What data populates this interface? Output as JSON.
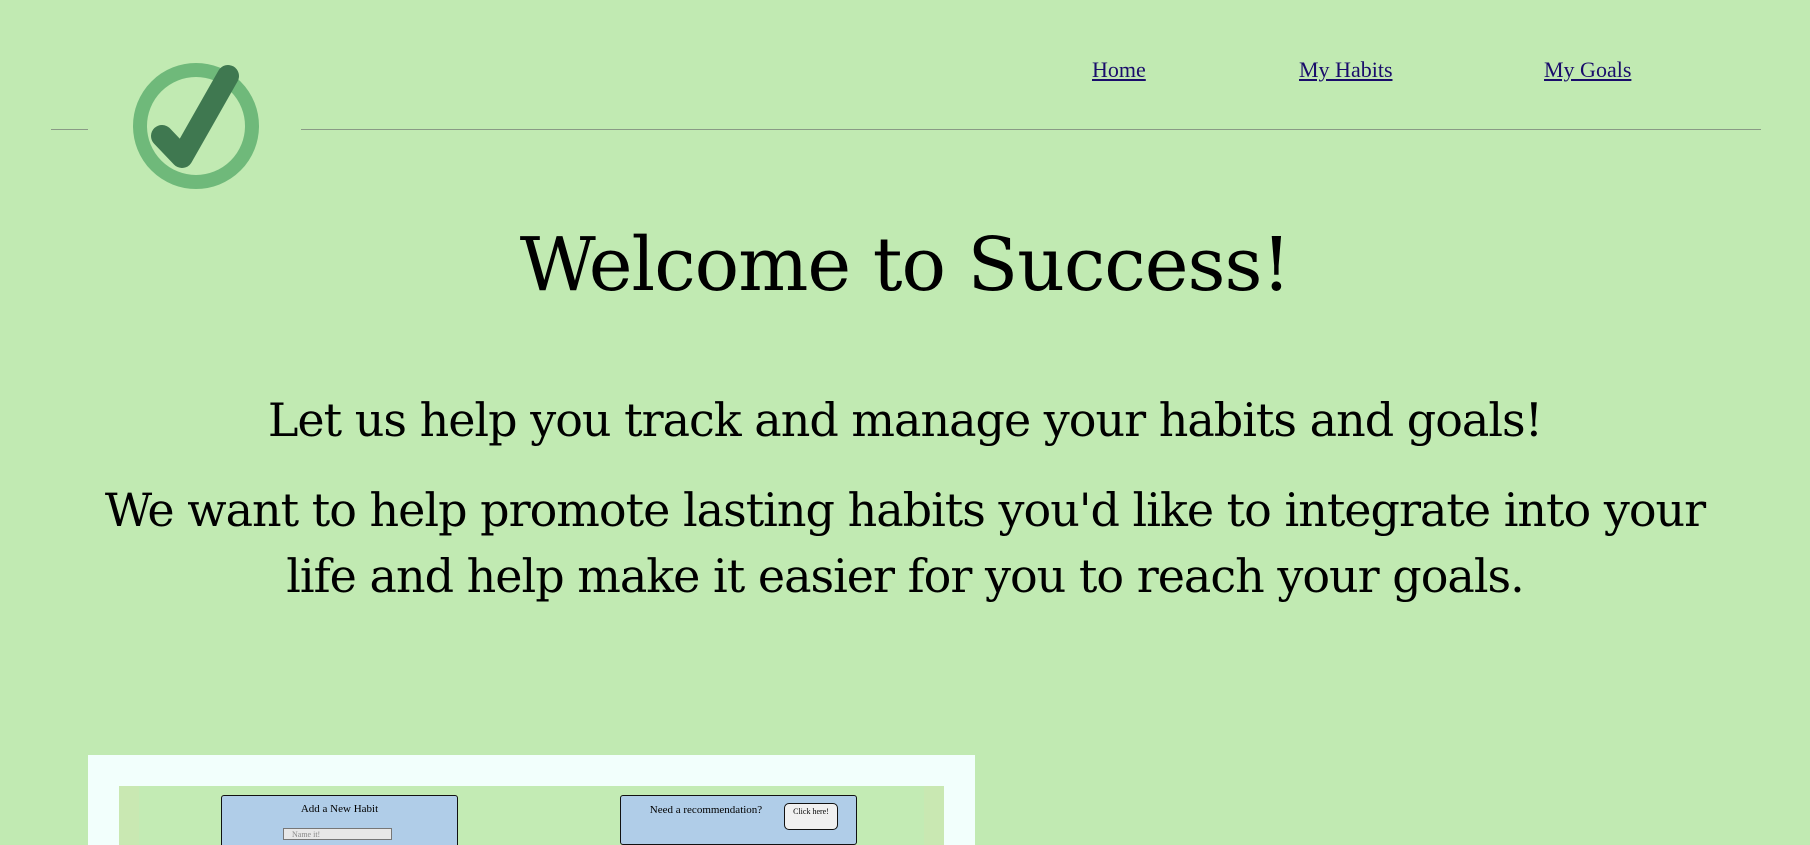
{
  "nav": {
    "home": "Home",
    "habits": "My Habits",
    "goals": "My Goals"
  },
  "logo": {
    "icon": "checkmark-circle-icon",
    "ring_color": "#6fb97a",
    "check_color": "#3f7850"
  },
  "hero": {
    "title": "Welcome to Success!",
    "subtitle": "Let us help you track and manage your habits and goals!",
    "paragraph": "We want to help promote lasting habits you'd like to integrate into your life and help make it easier for you to reach your goals."
  },
  "preview": {
    "add_habit_title": "Add a New Habit",
    "name_placeholder": "Name it!",
    "recommendation_text": "Need a recommendation?",
    "click_button": "Click here!"
  },
  "colors": {
    "background": "#c1eab2",
    "link": "#1a0d6b",
    "card": "#b0cde8"
  }
}
